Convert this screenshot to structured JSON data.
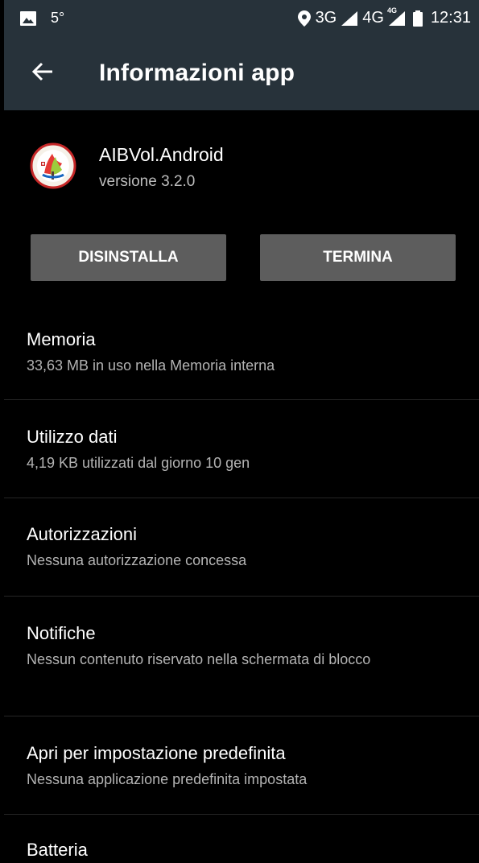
{
  "status_bar": {
    "temperature": "5°",
    "network_3g": "3G",
    "network_4g": "4G",
    "network_4g_badge": "4G",
    "time": "12:31",
    "icons": [
      "image-icon",
      "location-icon",
      "signal-icon",
      "battery-icon"
    ]
  },
  "app_bar": {
    "title": "Informazioni app",
    "back_icon": "arrow-back-icon"
  },
  "app": {
    "name": "AIBVol.Android",
    "version": "versione 3.2.0",
    "icon": "app-logo-icon"
  },
  "actions": {
    "uninstall_label": "DISINSTALLA",
    "stop_label": "TERMINA"
  },
  "settings": [
    {
      "title": "Memoria",
      "subtitle": "33,63 MB in uso nella Memoria interna"
    },
    {
      "title": "Utilizzo dati",
      "subtitle": "4,19 KB utilizzati dal giorno 10 gen"
    },
    {
      "title": "Autorizzazioni",
      "subtitle": "Nessuna autorizzazione concessa"
    },
    {
      "title": "Notifiche",
      "subtitle": "Nessun contenuto riservato nella schermata di blocco"
    },
    {
      "title": "Apri per impostazione predefinita",
      "subtitle": "Nessuna applicazione predefinita impostata"
    },
    {
      "title": "Batteria",
      "subtitle": ""
    }
  ],
  "colors": {
    "bar_background": "#27323a",
    "page_background": "#000000",
    "button_background": "#5d5d5d"
  }
}
